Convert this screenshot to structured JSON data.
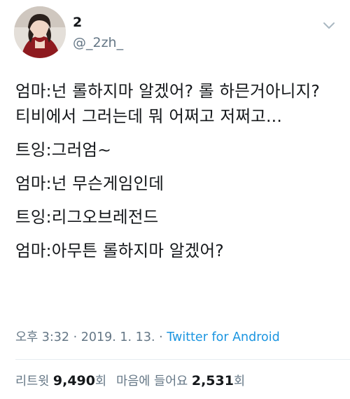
{
  "user": {
    "display_name": "2",
    "handle": "@_2zh_"
  },
  "tweet": {
    "paragraphs": [
      "엄마:넌 롤하지마 알겠어? 롤 하믄거아니지? 티비에서 그러는데 뭐 어쩌고 저쩌고...",
      "트잉:그러엄~",
      "엄마:넌 무슨게임인데",
      "트잉:리그오브레전드",
      "엄마:아무튼 롤하지마 알겠어?"
    ]
  },
  "meta": {
    "time": "오후 3:32",
    "separator1": " · ",
    "date": "2019. 1. 13.",
    "separator2": " · ",
    "source": "Twitter for Android"
  },
  "stats": {
    "retweets_label": "리트윗",
    "retweets_count": "9,490",
    "retweets_suffix": "회",
    "likes_label": "마음에 들어요",
    "likes_count": "2,531",
    "likes_suffix": "회"
  },
  "icons": {
    "menu": "chevron-down-icon"
  },
  "colors": {
    "text": "#14171a",
    "secondary": "#657786",
    "link": "#1b95e0",
    "divider": "#e6ecf0"
  }
}
